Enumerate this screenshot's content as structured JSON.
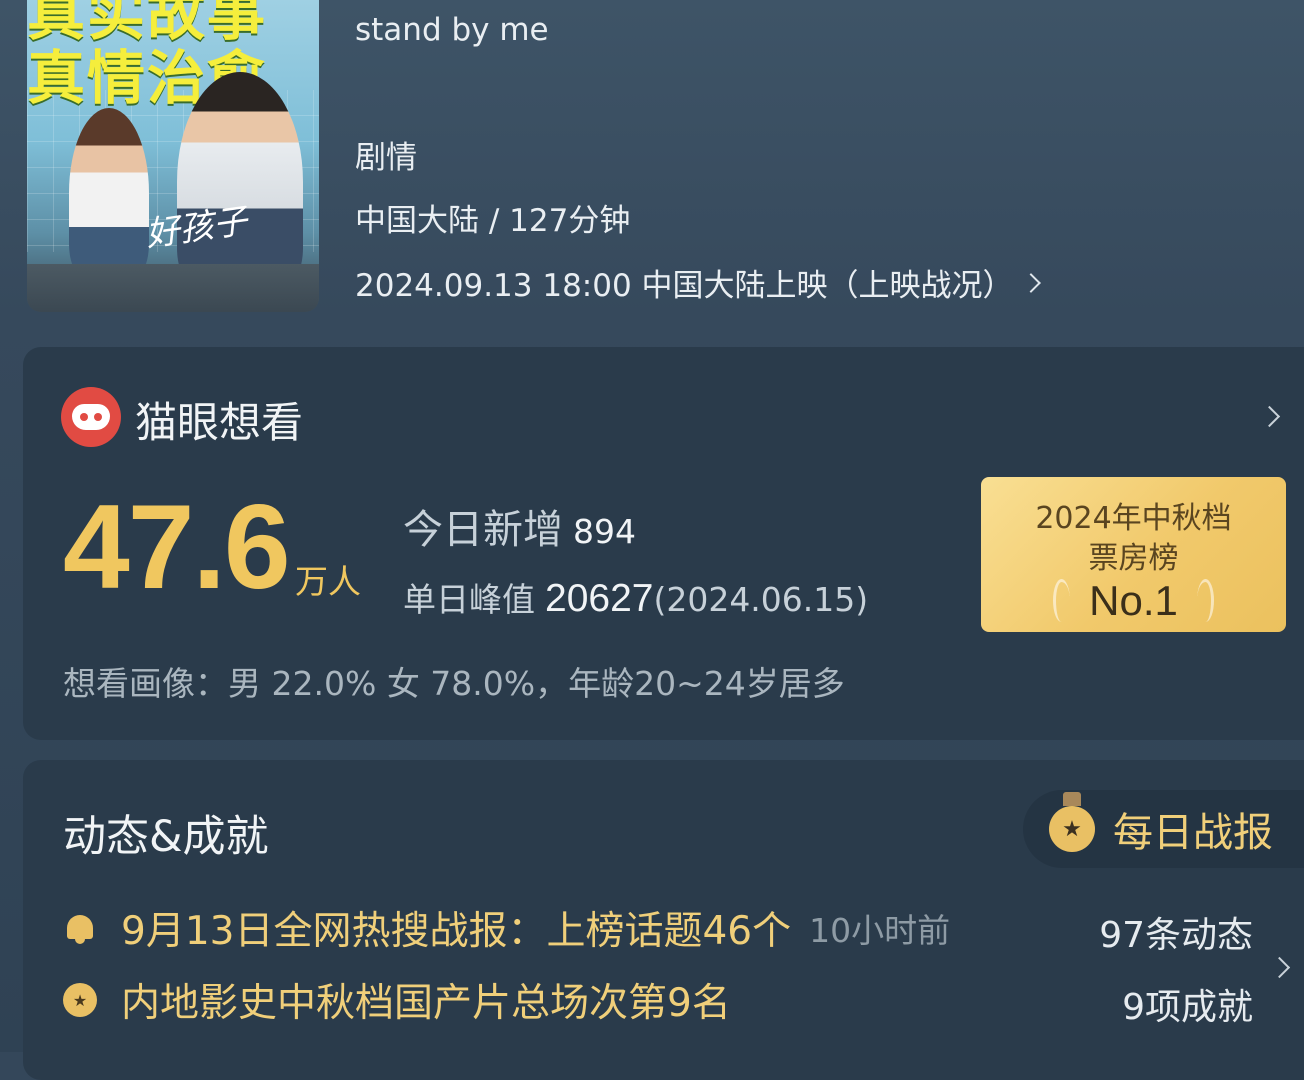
{
  "poster": {
    "title": "真实故事\n真情治愈",
    "script_text": "好孩子"
  },
  "movie": {
    "subtitle": "stand by me",
    "genre": "剧情",
    "region_duration": "中国大陆 / 127分钟",
    "release": "2024.09.13 18:00 中国大陆上映（上映战况）"
  },
  "want_to_see": {
    "title": "猫眼想看",
    "count": "47.6",
    "unit": "万人",
    "today_label": "今日新增",
    "today_value": "894",
    "peak_label": "单日峰值",
    "peak_value": "20627",
    "peak_date": "(2024.06.15)",
    "rank_line1": "2024年中秋档",
    "rank_line2": "票房榜",
    "rank_value": "No.1",
    "portrait": "想看画像：男 22.0%  女 78.0%，年龄20~24岁居多"
  },
  "achievements": {
    "title": "动态&成就",
    "daily_report": "每日战报",
    "items": [
      {
        "text": "9月13日全网热搜战报：上榜话题46个",
        "time": "10小时前",
        "count": "97条动态",
        "icon": "bell-icon"
      },
      {
        "text": "内地影史中秋档国产片总场次第9名",
        "time": "",
        "count": "9项成就",
        "icon": "medal-icon"
      }
    ]
  },
  "colors": {
    "accent_gold": "#f0c75f",
    "card_bg": "#2a3b4b",
    "maoyan_red": "#e14b43"
  }
}
